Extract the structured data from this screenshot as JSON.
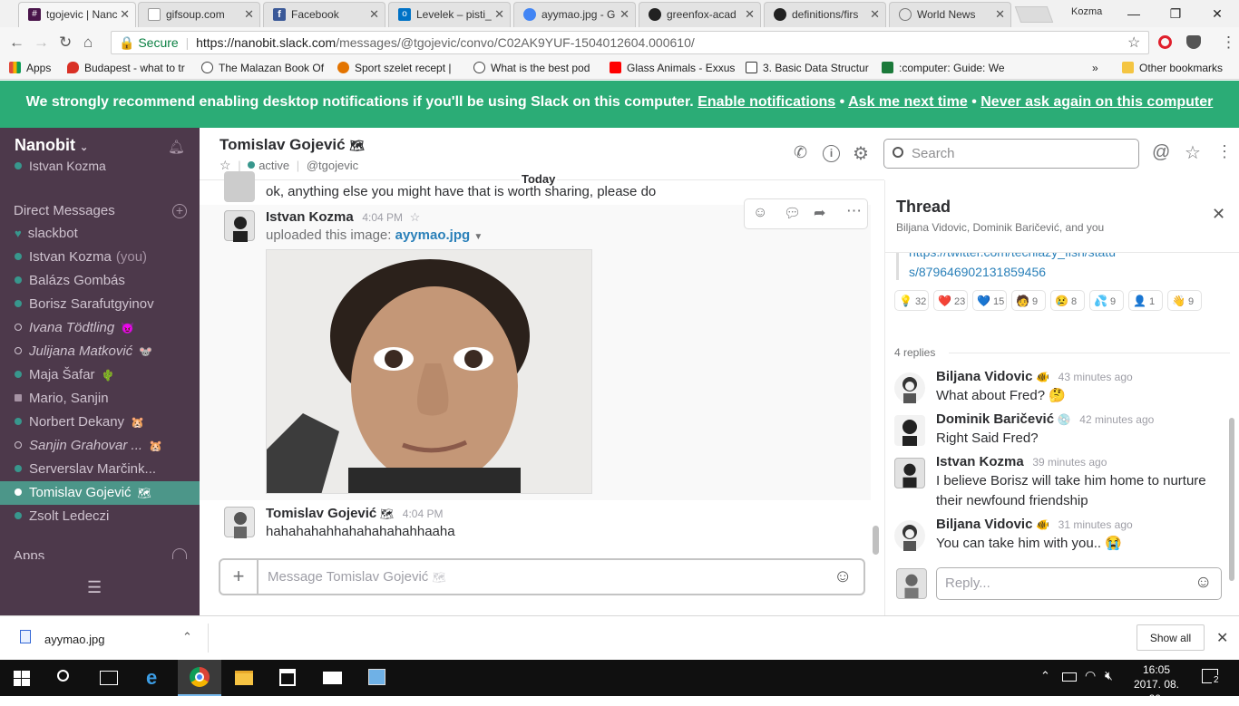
{
  "browser": {
    "tabs": [
      {
        "label": "tgojevic | Nanc",
        "color": "#4a154b"
      },
      {
        "label": "gifsoup.com",
        "color": "#bbbbbb"
      },
      {
        "label": "Facebook",
        "color": "#3b5998"
      },
      {
        "label": "Levelek – pisti_",
        "color": "#0072c6"
      },
      {
        "label": "ayymao.jpg - G",
        "color": "#4285f4"
      },
      {
        "label": "greenfox-acad",
        "color": "#222222"
      },
      {
        "label": "definitions/firs",
        "color": "#222222"
      },
      {
        "label": "World News",
        "color": "#888888"
      }
    ],
    "profile_name": "Kozma",
    "secure_label": "Secure",
    "url_host": "https://nanobit.slack.com",
    "url_path": "/messages/@tgojevic/convo/C02AK9YUF-1504012604.000610/",
    "bookmarks": [
      {
        "label": "Apps",
        "color": "#e24b3b"
      },
      {
        "label": "Budapest - what to tr",
        "color": "#d93025"
      },
      {
        "label": "The Malazan Book Of",
        "color": "#444444"
      },
      {
        "label": "Sport szelet recept | ",
        "color": "#e37400"
      },
      {
        "label": "What is the best pod",
        "color": "#444444"
      },
      {
        "label": "Glass Animals - Exxus",
        "color": "#ff0000"
      },
      {
        "label": "3. Basic Data Structur",
        "color": "#333333"
      },
      {
        "label": ":computer: Guide: We",
        "color": "#1b7a3a"
      }
    ],
    "other_bookmarks": "Other bookmarks"
  },
  "banner": {
    "text": "We strongly recommend enabling desktop notifications if you'll be using Slack on this computer.",
    "link1": "Enable notifications",
    "link2": "Ask me next time",
    "link3": "Never ask again on this computer"
  },
  "sidebar": {
    "team": "Nanobit",
    "user": "Istvan Kozma",
    "dm_header": "Direct Messages",
    "items": [
      {
        "label": "slackbot",
        "status": "heart"
      },
      {
        "label": "Istvan Kozma",
        "suffix": "(you)",
        "status": "on"
      },
      {
        "label": "Balázs Gombás",
        "status": "on"
      },
      {
        "label": "Borisz Sarafutgyinov",
        "status": "on"
      },
      {
        "label": "Ivana Tödtling",
        "emoji": "😈",
        "status": "off",
        "italic": true
      },
      {
        "label": "Julijana Matković",
        "emoji": "🐭",
        "status": "off",
        "italic": true
      },
      {
        "label": "Maja Šafar",
        "emoji": "🌵",
        "status": "on"
      },
      {
        "label": "Mario, Sanjin",
        "status": "group"
      },
      {
        "label": "Norbert Dekany",
        "emoji": "🐹",
        "status": "on"
      },
      {
        "label": "Sanjin Grahovar ...",
        "emoji": "🐹",
        "status": "off",
        "italic": true
      },
      {
        "label": "Serverslav Marčink...",
        "status": "on"
      },
      {
        "label": "Tomislav Gojević",
        "emoji": "🗺",
        "status": "on",
        "selected": true
      },
      {
        "label": "Zsolt Ledeczi",
        "status": "on"
      }
    ],
    "apps_header": "Apps"
  },
  "channel": {
    "name": "Tomislav Gojević",
    "presence": "active",
    "handle": "@tgojevic",
    "search_placeholder": "Search",
    "day_divider": "Today"
  },
  "messages": {
    "prev_text": "ok, anything else you might have that is worth sharing, please do",
    "m1_author": "Istvan Kozma",
    "m1_time": "4:04 PM",
    "m1_text": "uploaded this image:",
    "m1_file": "ayymao.jpg",
    "m2_author": "Tomislav Gojević",
    "m2_time": "4:04 PM",
    "m2_text": "hahahahahhahahahahahhaaha"
  },
  "composer": {
    "placeholder": "Message Tomislav Gojević",
    "plus": "+"
  },
  "thread": {
    "title": "Thread",
    "participants": "Biljana Vidovic, Dominik Baričević, and you",
    "link_line1": "https://twitter.com/techlazy_fish/statu",
    "link_line2": "s/879646902131859456",
    "reactions": [
      {
        "emoji": "💡",
        "count": "32"
      },
      {
        "emoji": "❤️",
        "count": "23"
      },
      {
        "emoji": "💙",
        "count": "15"
      },
      {
        "emoji": "🧑",
        "count": "9"
      },
      {
        "emoji": "😢",
        "count": "8"
      },
      {
        "emoji": "💦",
        "count": "9"
      },
      {
        "emoji": "👤",
        "count": "1"
      },
      {
        "emoji": "👋",
        "count": "9"
      }
    ],
    "replies_label": "4 replies",
    "replies": [
      {
        "author": "Biljana Vidovic",
        "badge": "🐠",
        "time": "43 minutes ago",
        "text": "What about Fred? 🤔"
      },
      {
        "author": "Dominik Baričević",
        "badge": "💿",
        "time": "42 minutes ago",
        "text": "Right Said Fred?"
      },
      {
        "author": "Istvan Kozma",
        "badge": "",
        "time": "39 minutes ago",
        "text": "I believe Borisz will take him home to nurture their newfound friendship"
      },
      {
        "author": "Biljana Vidovic",
        "badge": "🐠",
        "time": "31 minutes ago",
        "text": "You can take him with you..  😭"
      }
    ],
    "reply_placeholder": "Reply..."
  },
  "download": {
    "file": "ayymao.jpg",
    "show_all": "Show all"
  },
  "taskbar": {
    "time": "16:05",
    "date": "2017. 08. 29.",
    "notif_count": "2"
  }
}
